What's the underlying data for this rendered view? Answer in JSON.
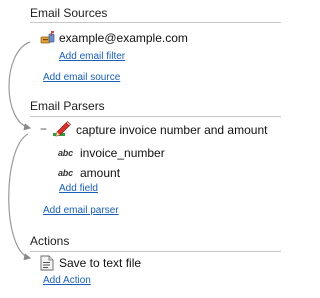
{
  "sections": {
    "sources": {
      "header": "Email Sources",
      "item": "example@example.com",
      "filter_link": "Add email filter",
      "add_link": "Add email source"
    },
    "parsers": {
      "header": "Email Parsers",
      "toggle": "−",
      "item": "capture invoice number and amount",
      "fields": [
        {
          "type_label": "abc",
          "name": "invoice_number"
        },
        {
          "type_label": "abc",
          "name": "amount"
        }
      ],
      "add_field_link": "Add field",
      "add_link": "Add email parser"
    },
    "actions": {
      "header": "Actions",
      "item": "Save to text file",
      "add_link": "Add Action"
    }
  },
  "icons": {
    "source": "mailbox-icon",
    "parser": "parser-pencil-icon",
    "action": "text-file-icon"
  },
  "colors": {
    "link": "#1a5fb4",
    "connector": "#9a9a9a",
    "separator": "#c8c8c8"
  }
}
